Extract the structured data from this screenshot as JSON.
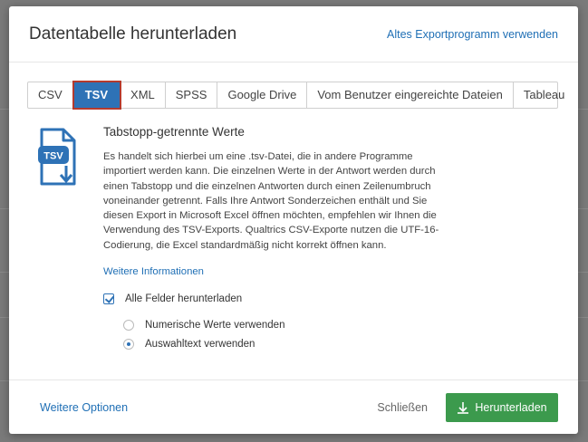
{
  "dialog": {
    "title": "Datentabelle herunterladen",
    "old_export_link": "Altes Exportprogramm verwenden"
  },
  "tabs": [
    {
      "label": "CSV",
      "active": false
    },
    {
      "label": "TSV",
      "active": true
    },
    {
      "label": "XML",
      "active": false
    },
    {
      "label": "SPSS",
      "active": false
    },
    {
      "label": "Google Drive",
      "active": false
    },
    {
      "label": "Vom Benutzer eingereichte Dateien",
      "active": false
    },
    {
      "label": "Tableau",
      "active": false
    }
  ],
  "content": {
    "icon_label": "TSV",
    "section_title": "Tabstopp-getrennte Werte",
    "description": "Es handelt sich hierbei um eine .tsv-Datei, die in andere Programme importiert werden kann. Die einzelnen Werte in der Antwort werden durch einen Tabstopp und die einzelnen Antworten durch einen Zeilenumbruch voneinander getrennt. Falls Ihre Antwort Sonderzeichen enthält und Sie diesen Export in Microsoft Excel öffnen möchten, empfehlen wir Ihnen die Verwendung des TSV-Exports. Qualtrics CSV-Exporte nutzen die UTF-16-Codierung, die Excel standardmäßig nicht korrekt öffnen kann.",
    "more_info_link": "Weitere Informationen",
    "checkbox_all_fields": {
      "label": "Alle Felder herunterladen",
      "checked": true
    },
    "radio_options": [
      {
        "label": "Numerische Werte verwenden",
        "selected": false
      },
      {
        "label": "Auswahltext verwenden",
        "selected": true
      }
    ]
  },
  "footer": {
    "more_options": "Weitere Optionen",
    "close_label": "Schließen",
    "download_label": "Herunterladen"
  },
  "colors": {
    "accent_blue": "#2e72b6",
    "link_blue": "#1f6fb5",
    "download_green": "#3c9a4d",
    "active_tab_outline": "#b53a2d"
  }
}
